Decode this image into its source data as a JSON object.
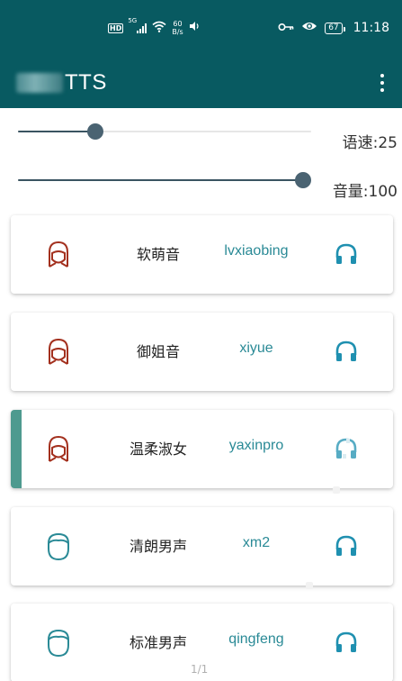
{
  "status_bar": {
    "hd": "HD",
    "network": "5G",
    "speed_value": "60",
    "speed_unit": "B/s",
    "battery": "67",
    "time": "11:18",
    "icons": [
      "signal-icon",
      "wifi-icon",
      "vibrate-icon",
      "key-icon",
      "eye-icon"
    ]
  },
  "toolbar": {
    "title": "TTS",
    "menu_icon": "more-vertical-icon"
  },
  "speed_slider": {
    "label": "语速:25",
    "value": 25,
    "max": 100
  },
  "volume_slider": {
    "label": "音量:100",
    "value": 100,
    "max": 100
  },
  "voices": [
    {
      "name": "软萌音",
      "id": "lvxiaobing",
      "gender": "female",
      "selected": false
    },
    {
      "name": "御姐音",
      "id": "xiyue",
      "gender": "female",
      "selected": false
    },
    {
      "name": "温柔淑女",
      "id": "yaxinpro",
      "gender": "female",
      "selected": true
    },
    {
      "name": "清朗男声",
      "id": "xm2",
      "gender": "male",
      "selected": false
    },
    {
      "name": "标准男声",
      "id": "qingfeng",
      "gender": "male",
      "selected": false
    }
  ],
  "colors": {
    "primary": "#085A61",
    "accent_teal": "#2A8A96",
    "female_icon": "#A3301E",
    "male_icon": "#2A8A96",
    "headphone": "#1F90B0",
    "slider": "#3A5461",
    "selected_bar": "#4E9A8F"
  },
  "page_indicator": "1/1"
}
